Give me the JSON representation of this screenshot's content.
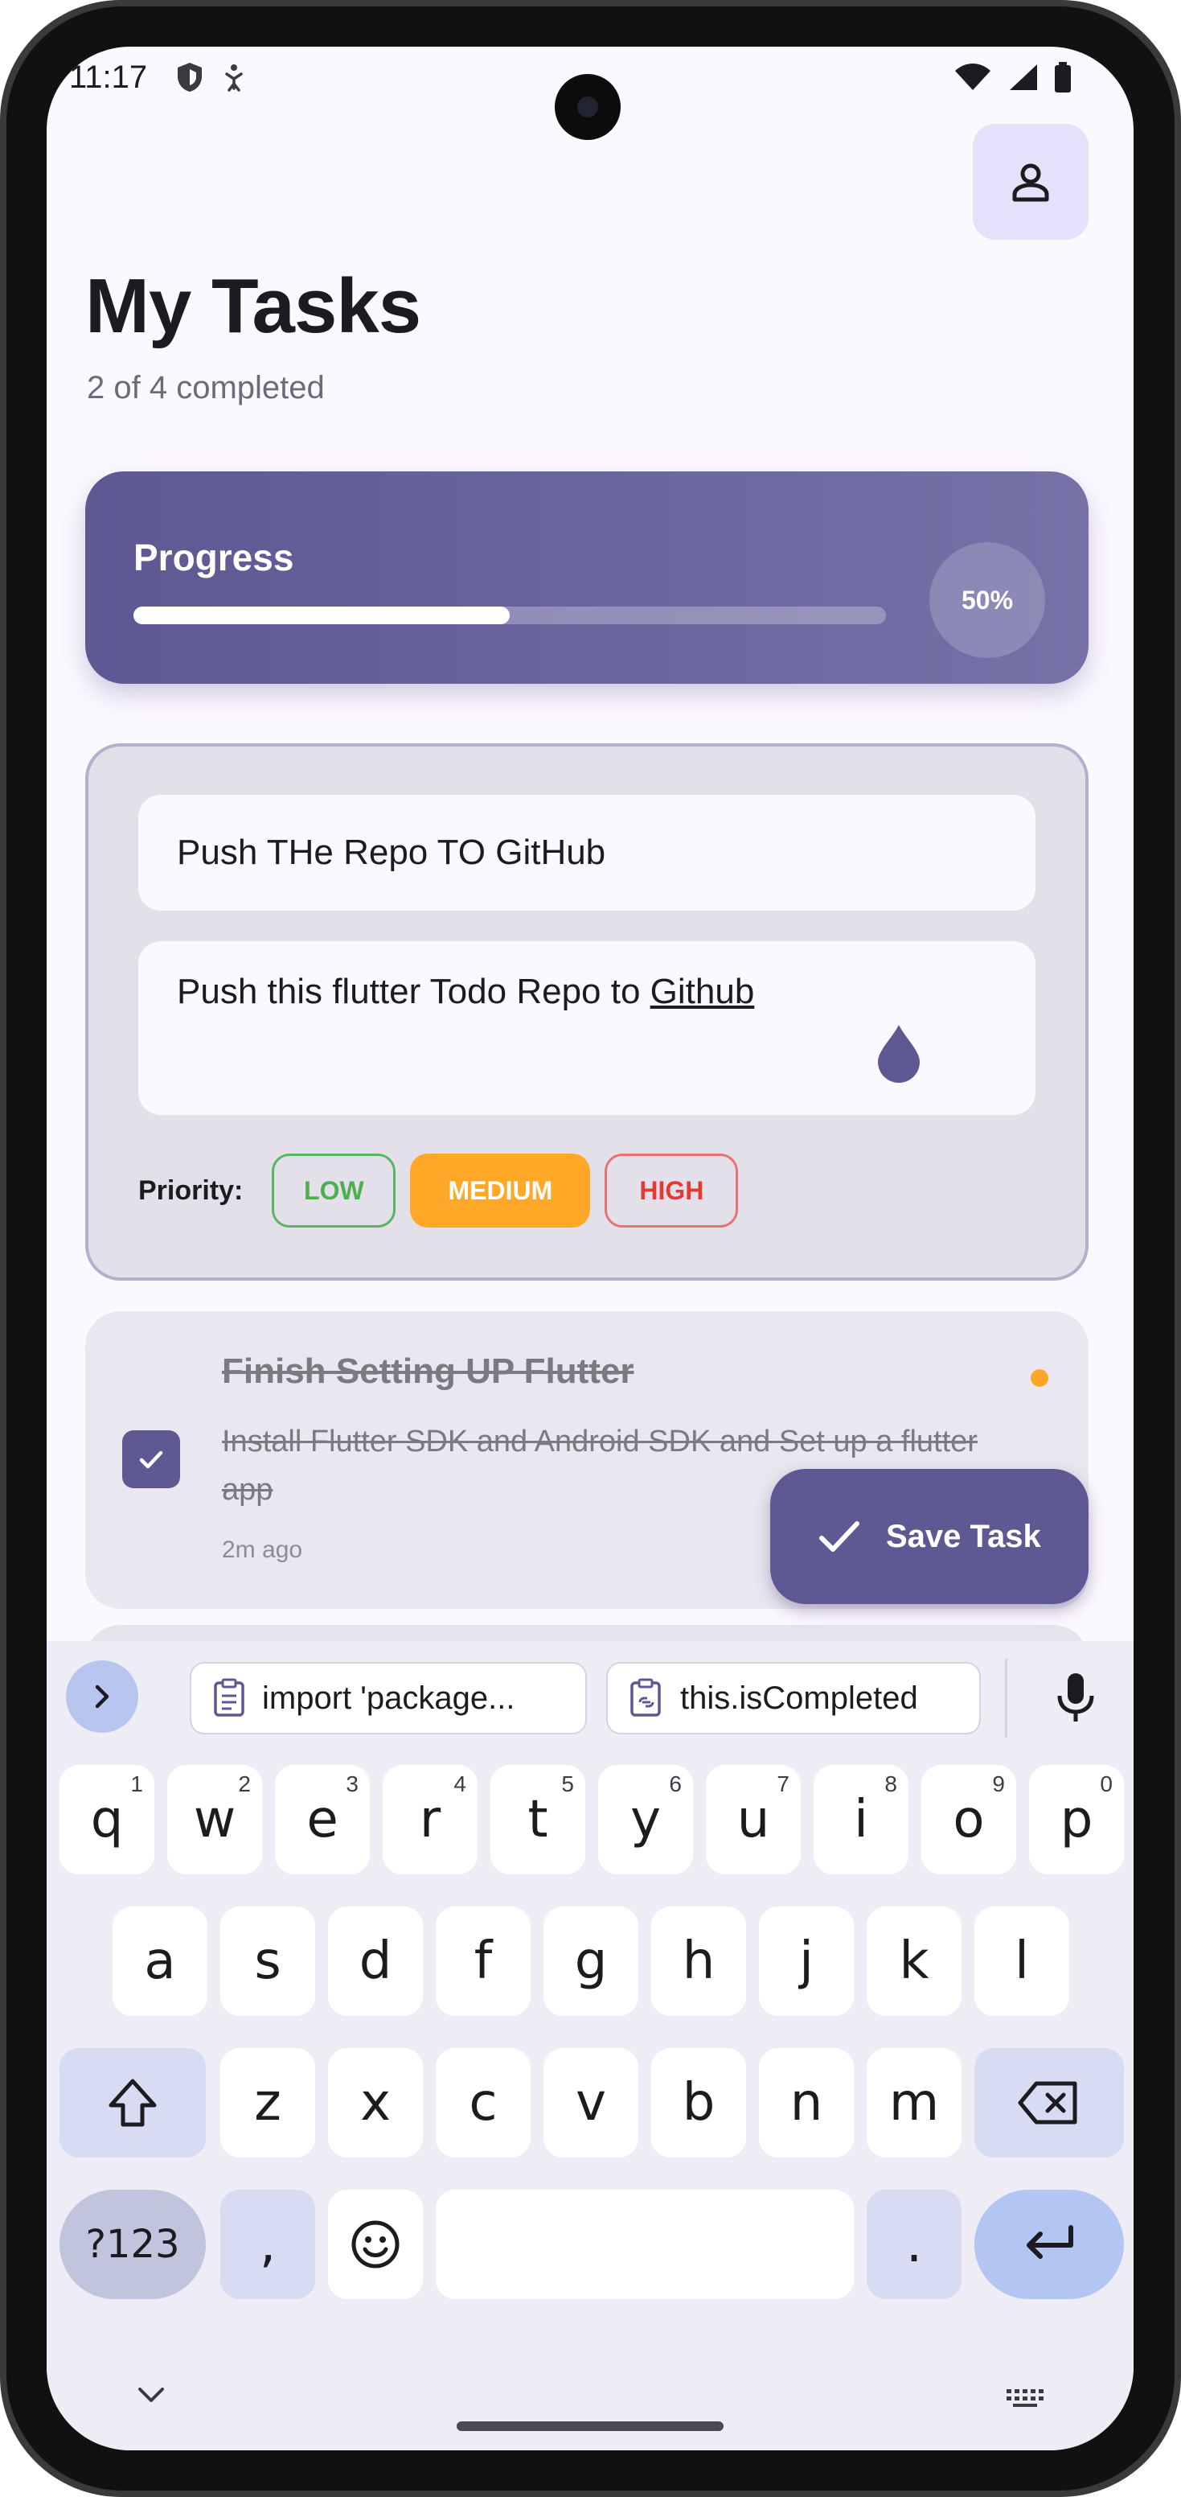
{
  "status": {
    "time": "11:17"
  },
  "header": {
    "title": "My Tasks",
    "subtitle": "2 of 4 completed"
  },
  "progress": {
    "label": "Progress",
    "percent_text": "50%",
    "fraction": 0.5
  },
  "form": {
    "title_value": "Push THe Repo TO GitHub",
    "description_prefix": "Push this flutter Todo Repo to ",
    "description_link": "Github",
    "priority_label": "Priority:",
    "priorities": [
      "LOW",
      "MEDIUM",
      "HIGH"
    ],
    "selected_priority": "MEDIUM"
  },
  "tasks": [
    {
      "title": "Finish Setting UP Flutter",
      "description": "Install Flutter SDK and Android SDK and Set up a flutter app",
      "time": "2m ago",
      "completed": true,
      "priority_color": "#ffa726"
    }
  ],
  "fab": {
    "label": "Save Task"
  },
  "keyboard": {
    "clipboard": [
      "import 'package...",
      "this.isCompleted"
    ],
    "row1": [
      "q",
      "w",
      "e",
      "r",
      "t",
      "y",
      "u",
      "i",
      "o",
      "p"
    ],
    "row1_hints": [
      "1",
      "2",
      "3",
      "4",
      "5",
      "6",
      "7",
      "8",
      "9",
      "0"
    ],
    "row2": [
      "a",
      "s",
      "d",
      "f",
      "g",
      "h",
      "j",
      "k",
      "l"
    ],
    "row3": [
      "z",
      "x",
      "c",
      "v",
      "b",
      "n",
      "m"
    ],
    "symbols_key": "?123",
    "comma_key": ",",
    "period_key": "."
  },
  "colors": {
    "accent": "#5e5893",
    "medium": "#ffa726",
    "low": "#4caf50",
    "high": "#e53935"
  }
}
